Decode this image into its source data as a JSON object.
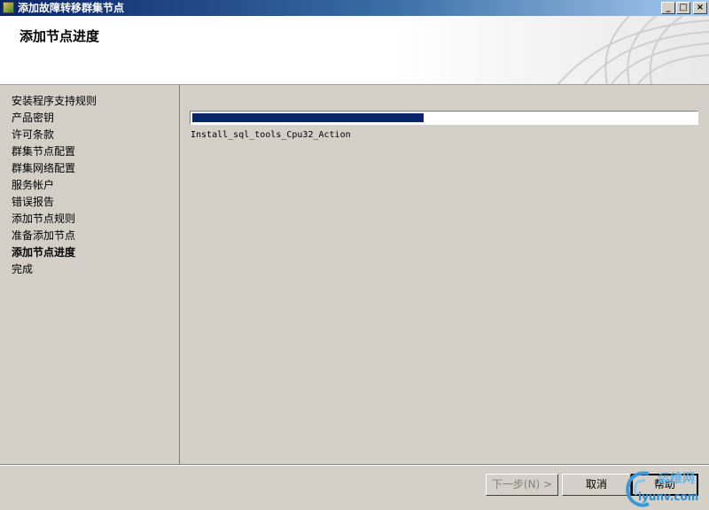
{
  "window": {
    "title": "添加故障转移群集节点",
    "icon": "installer-icon",
    "controls": {
      "minimize": "_",
      "maximize": "□",
      "close": "×"
    }
  },
  "header": {
    "title": "添加节点进度"
  },
  "sidebar": {
    "items": [
      {
        "label": "安装程序支持规则",
        "active": false
      },
      {
        "label": "产品密钥",
        "active": false
      },
      {
        "label": "许可条款",
        "active": false
      },
      {
        "label": "群集节点配置",
        "active": false
      },
      {
        "label": "群集网络配置",
        "active": false
      },
      {
        "label": "服务帐户",
        "active": false
      },
      {
        "label": "错误报告",
        "active": false
      },
      {
        "label": "添加节点规则",
        "active": false
      },
      {
        "label": "准备添加节点",
        "active": false
      },
      {
        "label": "添加节点进度",
        "active": true
      },
      {
        "label": "完成",
        "active": false
      }
    ]
  },
  "progress": {
    "value": 0.46,
    "action": "Install_sql_tools_Cpu32_Action",
    "color": "#0a246a"
  },
  "buttons": {
    "next": "下一步(N) >",
    "cancel": "取消",
    "help": "帮助"
  },
  "watermark": {
    "cn": "运维网",
    "url": "iyunv.com"
  }
}
